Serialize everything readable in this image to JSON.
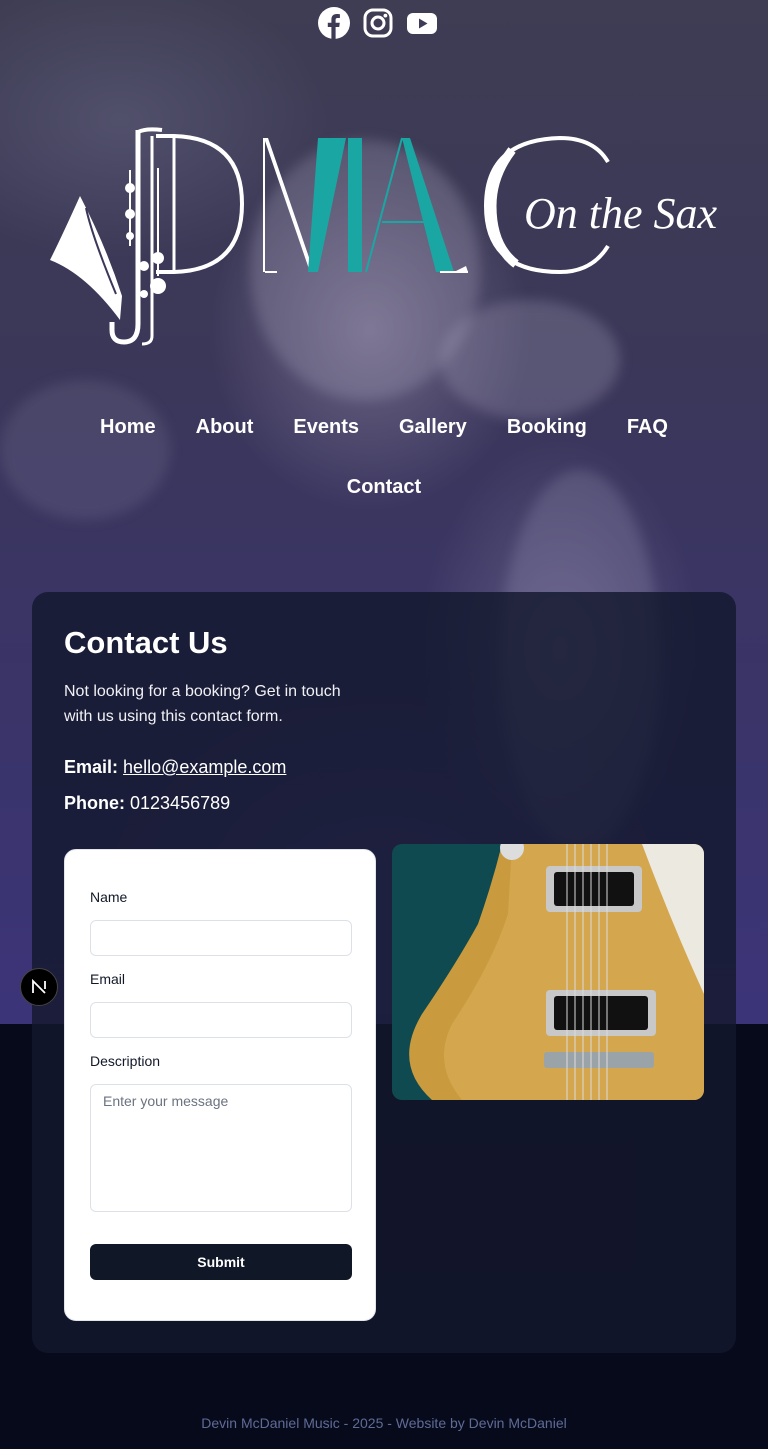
{
  "socials": [
    {
      "name": "facebook",
      "icon": "facebook-icon"
    },
    {
      "name": "instagram",
      "icon": "instagram-icon"
    },
    {
      "name": "youtube",
      "icon": "youtube-icon"
    }
  ],
  "logo": {
    "mark": "DMAC",
    "tagline": "On the Sax",
    "accent_color": "#1aa7a3"
  },
  "nav": {
    "items": [
      "Home",
      "About",
      "Events",
      "Gallery",
      "Booking",
      "FAQ",
      "Contact"
    ]
  },
  "contact": {
    "title": "Contact Us",
    "intro": "Not looking for a booking? Get in touch with us using this contact form.",
    "email_label": "Email:",
    "email_value": "hello@example.com",
    "phone_label": "Phone:",
    "phone_value": "0123456789"
  },
  "form": {
    "name_label": "Name",
    "email_label": "Email",
    "description_label": "Description",
    "description_placeholder": "Enter your message",
    "submit_label": "Submit"
  },
  "badge": {
    "letter": "N",
    "icon": "nextjs-icon"
  },
  "footer": {
    "text": "Devin McDaniel Music - 2025 - Website by Devin McDaniel"
  },
  "colors": {
    "card_bg": "#14182d",
    "footer_text": "#5e6b96",
    "submit_bg": "#101827",
    "page_bg": "#070a1a"
  }
}
